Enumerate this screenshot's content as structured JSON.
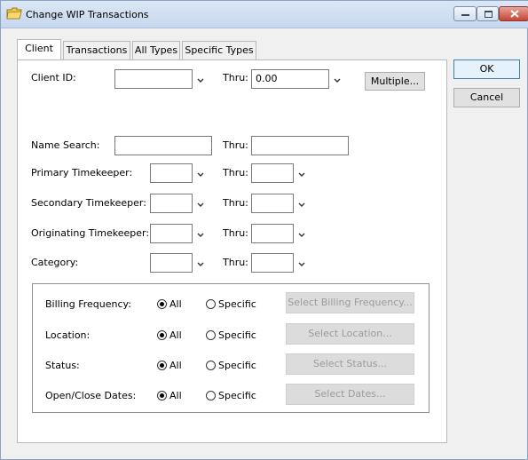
{
  "window": {
    "title": "Change WIP Transactions"
  },
  "tabs": [
    {
      "label": "Client",
      "active": true
    },
    {
      "label": "Transactions",
      "active": false
    },
    {
      "label": "All Types",
      "active": false
    },
    {
      "label": "Specific Types",
      "active": false
    }
  ],
  "buttons": {
    "ok": "OK",
    "cancel": "Cancel",
    "multiple": "Multiple..."
  },
  "client": {
    "client_id_label": "Client ID:",
    "client_id_value": "",
    "thru_label": "Thru:",
    "thru_value": "0.00"
  },
  "name_search": {
    "label": "Name Search:",
    "value": "",
    "thru_label": "Thru:",
    "thru_value": ""
  },
  "ranges": [
    {
      "label": "Primary Timekeeper:",
      "value": "",
      "thru_label": "Thru:",
      "thru_value": ""
    },
    {
      "label": "Secondary Timekeeper:",
      "value": "",
      "thru_label": "Thru:",
      "thru_value": ""
    },
    {
      "label": "Originating Timekeeper:",
      "value": "",
      "thru_label": "Thru:",
      "thru_value": ""
    },
    {
      "label": "Category:",
      "value": "",
      "thru_label": "Thru:",
      "thru_value": ""
    }
  ],
  "filters": [
    {
      "label": "Billing Frequency:",
      "all_label": "All",
      "specific_label": "Specific",
      "selected": "All",
      "button": "Select Billing Frequency..."
    },
    {
      "label": "Location:",
      "all_label": "All",
      "specific_label": "Specific",
      "selected": "All",
      "button": "Select Location..."
    },
    {
      "label": "Status:",
      "all_label": "All",
      "specific_label": "Specific",
      "selected": "All",
      "button": "Select Status..."
    },
    {
      "label": "Open/Close Dates:",
      "all_label": "All",
      "specific_label": "Specific",
      "selected": "All",
      "button": "Select Dates..."
    }
  ],
  "colors": {
    "title_bar": "#dbe7f5",
    "close_button": "#c64533",
    "disabled_button_text": "#9b9b9b"
  }
}
